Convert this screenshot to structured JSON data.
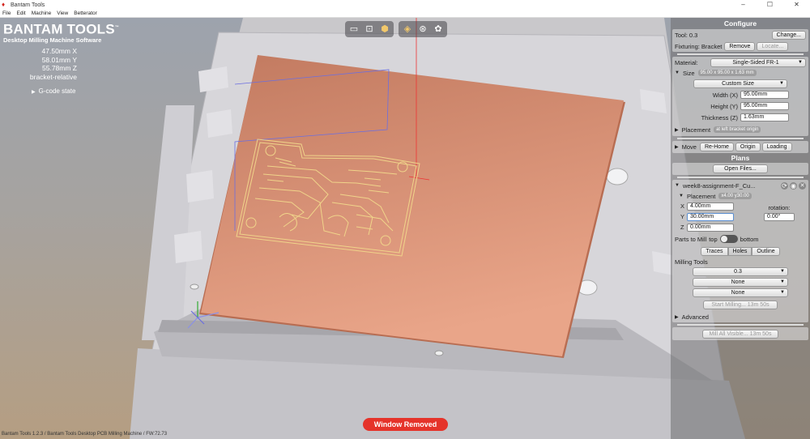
{
  "window": {
    "title": "Bantam Tools",
    "min": "–",
    "max": "☐",
    "close": "✕"
  },
  "menu": [
    "File",
    "Edit",
    "Machine",
    "View",
    "Betterator"
  ],
  "brand": {
    "name": "BANTAM TOOLS",
    "tm": "™",
    "subtitle": "Desktop Milling Machine Software"
  },
  "coords": {
    "x": "47.50mm X",
    "y": "58.01mm Y",
    "z": "55.78mm Z",
    "mode": "bracket-relative"
  },
  "gcode": {
    "label": "G-code state"
  },
  "icons": {
    "view_group": [
      "book-icon",
      "frame-icon",
      "box-icon"
    ],
    "render_group": [
      "layers-icon",
      "circles-icon",
      "palette-icon"
    ]
  },
  "configure": {
    "title": "Configure",
    "tool_label": "Tool: 0.3",
    "change_btn": "Change...",
    "fixturing_label": "Fixturing: Bracket",
    "remove_btn": "Remove",
    "locate_btn": "Locate...",
    "material_label": "Material:",
    "material_value": "Single-Sided FR-1",
    "size_label": "Size",
    "size_badge": "95.00 x 95.00 x 1.63 mm",
    "size_preset": "Custom Size",
    "width_label": "Width (X)",
    "width_value": "95.00mm",
    "height_label": "Height (Y)",
    "height_value": "95.00mm",
    "thickness_label": "Thickness (Z)",
    "thickness_value": "1.63mm",
    "placement_label": "Placement",
    "placement_badge": "at left bracket origin",
    "move_label": "Move",
    "rehome_btn": "Re-Home",
    "origin_btn": "Origin",
    "loading_btn": "Loading"
  },
  "plans": {
    "title": "Plans",
    "open_btn": "Open Files...",
    "file_name": "week8-assignment-F_Cu...",
    "placement_label": "Placement",
    "placement_badge": "x4.00 y30.00",
    "x_label": "X",
    "x_value": "4.00mm",
    "y_label": "Y",
    "y_value": "30.00mm",
    "z_label": "Z",
    "z_value": "0.00mm",
    "rotation_label": "rotation:",
    "rotation_value": "0.00°",
    "parts_label": "Parts to Mill",
    "top_label": "top",
    "bottom_label": "bottom",
    "traces_btn": "Traces",
    "holes_btn": "Holes",
    "outline_btn": "Outline",
    "milling_label": "Milling Tools",
    "tool1": "0.3",
    "tool2": "None",
    "tool3": "None",
    "start_btn": "Start Milling... 13m 50s",
    "advanced_label": "Advanced",
    "mill_all_btn": "Mill All Visible... 13m 50s"
  },
  "status": {
    "text": "Bantam Tools 1.2.3 / Bantam Tools Desktop PCB Milling Machine / FW:72.73"
  },
  "toast": {
    "text": "Window Removed",
    "color": "#e5332a"
  },
  "colors": {
    "copper": "#e39a7b",
    "trace": "#f0d48a",
    "bed": "#d2d2d7"
  }
}
